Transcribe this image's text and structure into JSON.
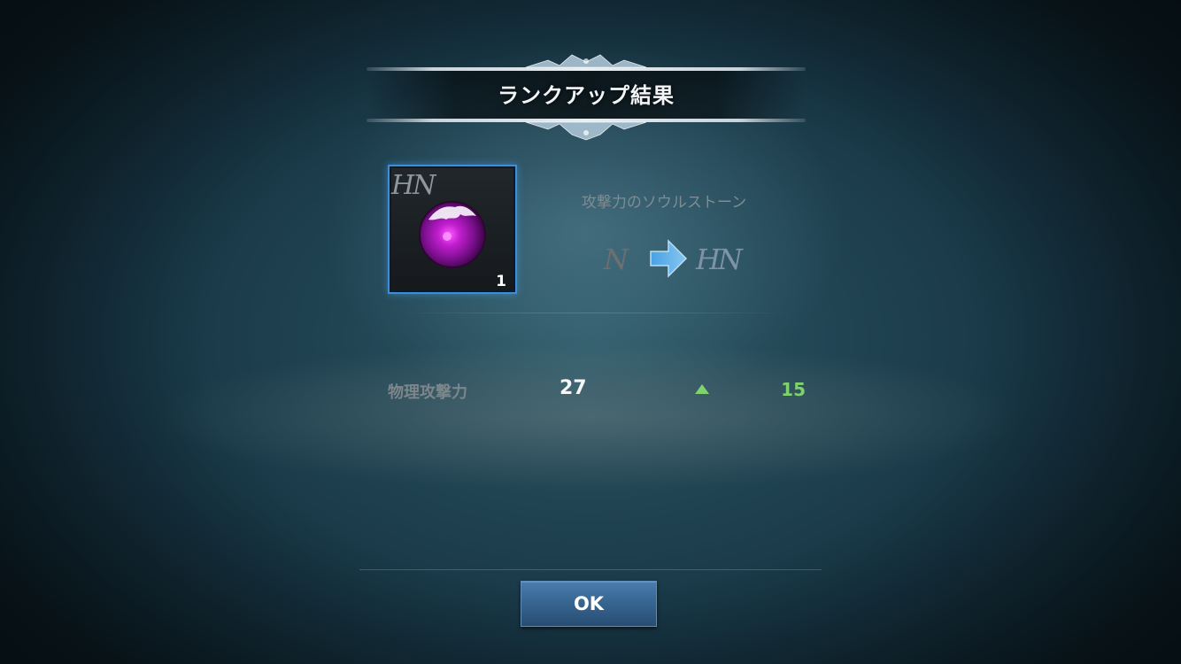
{
  "dialog": {
    "title": "ランクアップ結果"
  },
  "item": {
    "icon": "purple-soul-stone-orb",
    "rank_badge": "HN",
    "count": "1",
    "name": "攻撃力のソウルストーン"
  },
  "rank_change": {
    "from": "N",
    "to": "HN",
    "arrow_icon": "right-arrow-icon"
  },
  "stats": [
    {
      "label": "物理攻撃力",
      "value": "27",
      "increase": "15",
      "trend_icon": "up-triangle-icon"
    }
  ],
  "footer": {
    "ok_label": "OK"
  },
  "colors": {
    "accent_blue": "#3d8ed6",
    "increase_green": "#7fd36e",
    "button_blue": "#36648f"
  }
}
